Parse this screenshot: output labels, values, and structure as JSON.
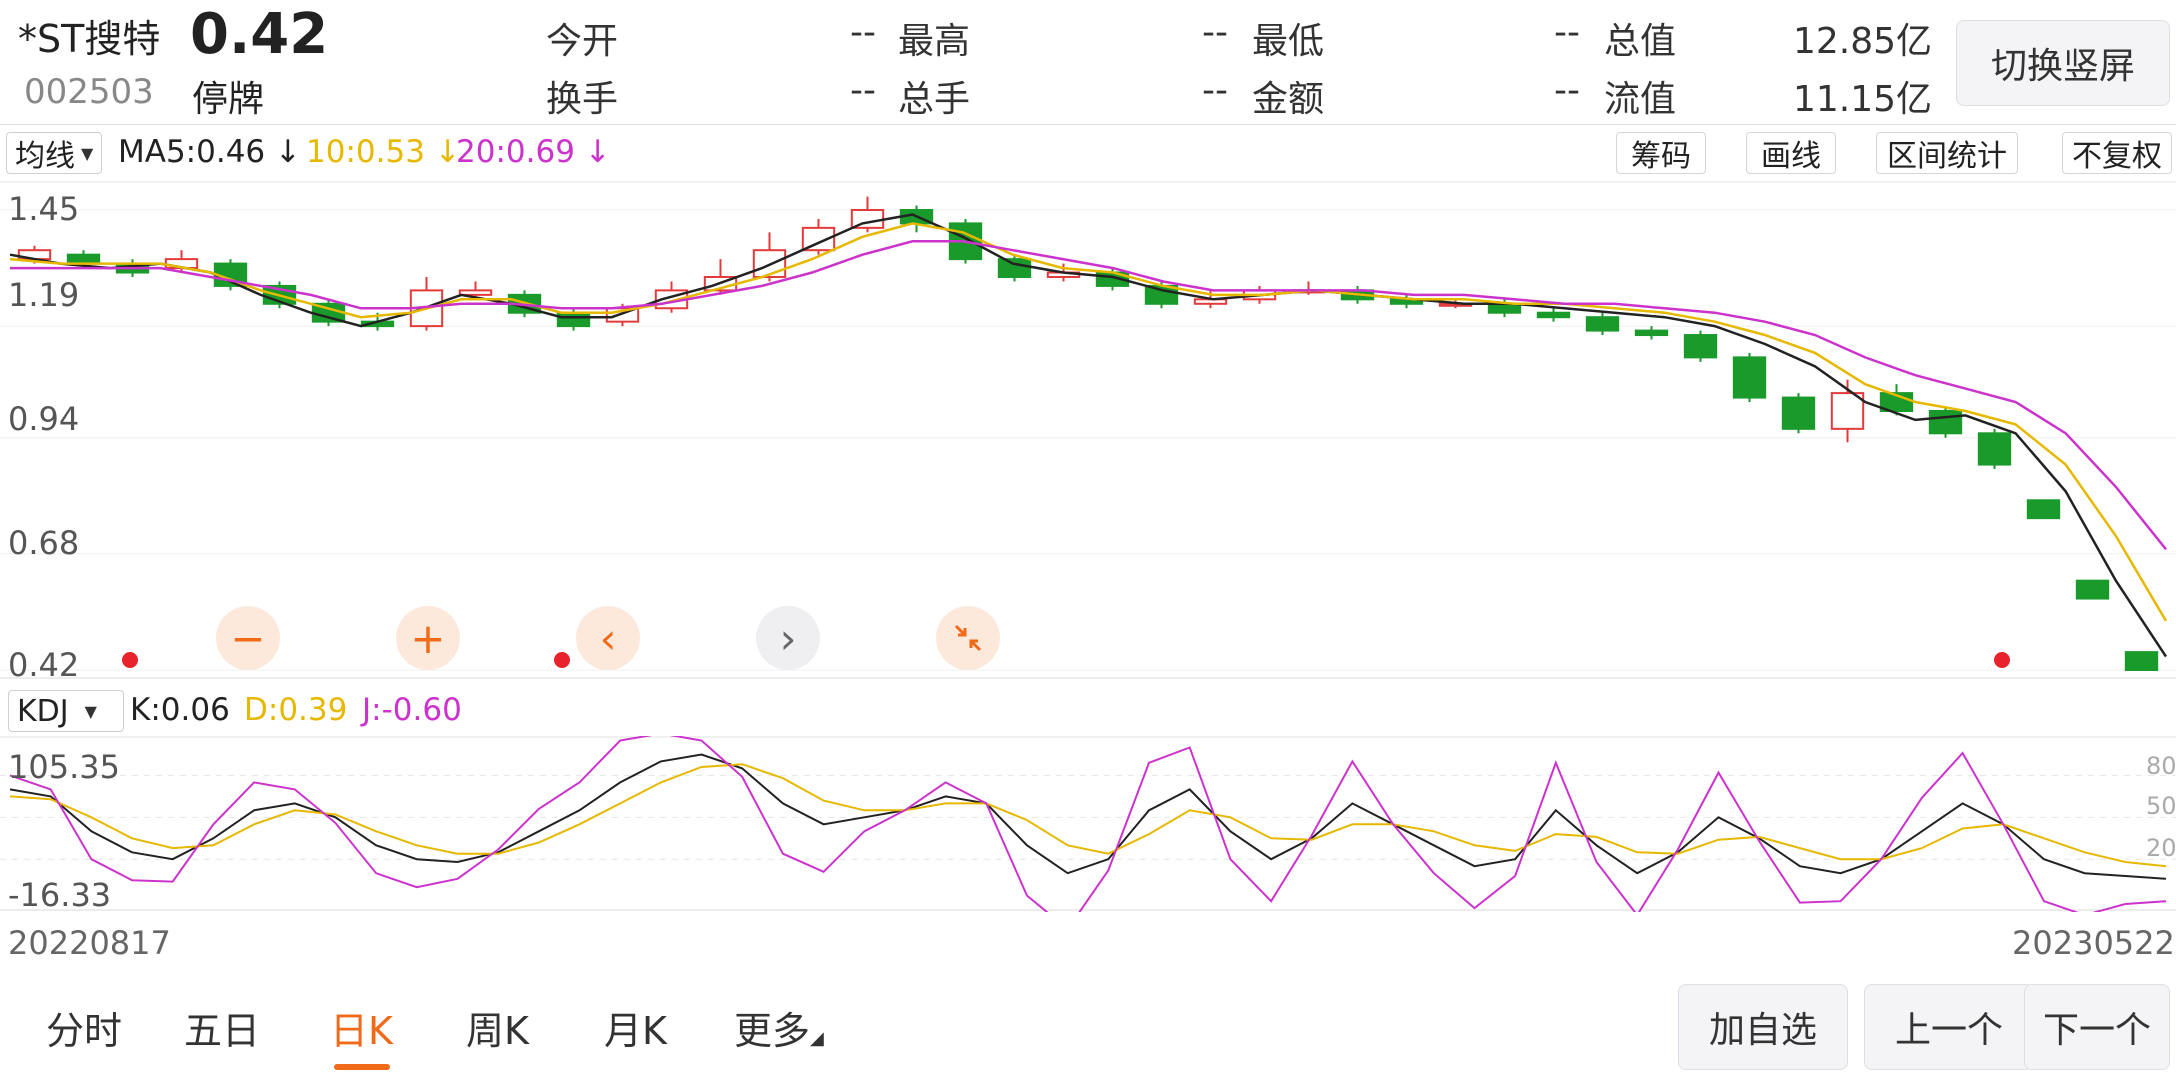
{
  "stock": {
    "name": "*ST搜特",
    "price": "0.42",
    "code": "002503",
    "status": "停牌",
    "quote": [
      {
        "label": "今开",
        "value": "--"
      },
      {
        "label": "最高",
        "value": "--"
      },
      {
        "label": "最低",
        "value": "--"
      },
      {
        "label": "总值",
        "value": "12.85亿"
      },
      {
        "label": "换手",
        "value": "--"
      },
      {
        "label": "总手",
        "value": "--"
      },
      {
        "label": "金额",
        "value": "--"
      },
      {
        "label": "流值",
        "value": "11.15亿"
      }
    ],
    "switch_label": "切换竖屏"
  },
  "ma_bar": {
    "selector": "均线",
    "ma5": "MA5:0.46",
    "ma10": "10:0.53",
    "ma20": "20:0.69",
    "arrow": "↓",
    "buttons": [
      "筹码",
      "画线",
      "区间统计",
      "不复权"
    ]
  },
  "colors": {
    "up": "#e33b3b",
    "down": "#1a9a2a",
    "ma5": "#222222",
    "ma10": "#e6b800",
    "ma20": "#cc33cc",
    "accent": "#f06a1a"
  },
  "price_axis": [
    "1.45",
    "1.19",
    "0.94",
    "0.68",
    "0.42"
  ],
  "controls": [
    {
      "name": "zoom-out-icon",
      "glyph": "−"
    },
    {
      "name": "zoom-in-icon",
      "glyph": "+"
    },
    {
      "name": "chevron-left-icon",
      "glyph": "‹"
    },
    {
      "name": "chevron-right-icon",
      "glyph": "›"
    },
    {
      "name": "collapse-icon",
      "glyph": ""
    }
  ],
  "kdj_bar": {
    "selector": "KDJ",
    "k": "K:0.06",
    "d": "D:0.39",
    "j": "J:-0.60"
  },
  "kdj_axis": {
    "top": "105.35",
    "bottom": "-16.33",
    "right": [
      "80",
      "50",
      "20"
    ]
  },
  "dates": {
    "start": "20220817",
    "end": "20230522"
  },
  "tabs": [
    "分时",
    "五日",
    "日K",
    "周K",
    "月K",
    "更多"
  ],
  "active_tab": "日K",
  "nav": [
    "加自选",
    "上一个",
    "下一个"
  ],
  "chart_data": [
    {
      "type": "candlestick",
      "title": "",
      "ylim": [
        0.42,
        1.45
      ],
      "series": [
        {
          "name": "MA5",
          "values": [
            1.35,
            1.33,
            1.32,
            1.33,
            1.31,
            1.26,
            1.22,
            1.19,
            1.22,
            1.26,
            1.24,
            1.21,
            1.21,
            1.25,
            1.28,
            1.32,
            1.37,
            1.42,
            1.44,
            1.39,
            1.33,
            1.31,
            1.3,
            1.27,
            1.25,
            1.26,
            1.27,
            1.26,
            1.25,
            1.24,
            1.24,
            1.23,
            1.22,
            1.21,
            1.19,
            1.15,
            1.1,
            1.02,
            0.98,
            0.99,
            0.95,
            0.82,
            0.62,
            0.45
          ]
        },
        {
          "name": "10",
          "values": [
            1.34,
            1.33,
            1.33,
            1.33,
            1.31,
            1.27,
            1.24,
            1.21,
            1.22,
            1.25,
            1.25,
            1.22,
            1.22,
            1.24,
            1.27,
            1.3,
            1.34,
            1.39,
            1.42,
            1.4,
            1.35,
            1.32,
            1.31,
            1.28,
            1.26,
            1.26,
            1.27,
            1.26,
            1.25,
            1.25,
            1.24,
            1.24,
            1.23,
            1.22,
            1.2,
            1.17,
            1.13,
            1.06,
            1.02,
            1.0,
            0.97,
            0.88,
            0.72,
            0.53
          ]
        },
        {
          "name": "20",
          "values": [
            1.32,
            1.32,
            1.32,
            1.32,
            1.3,
            1.28,
            1.26,
            1.23,
            1.23,
            1.24,
            1.24,
            1.23,
            1.23,
            1.24,
            1.26,
            1.28,
            1.31,
            1.35,
            1.38,
            1.38,
            1.36,
            1.34,
            1.32,
            1.29,
            1.27,
            1.27,
            1.27,
            1.27,
            1.26,
            1.26,
            1.25,
            1.24,
            1.24,
            1.23,
            1.22,
            1.2,
            1.17,
            1.12,
            1.08,
            1.05,
            1.02,
            0.95,
            0.83,
            0.69
          ]
        }
      ],
      "candles": [
        [
          1.34,
          1.36,
          1.37,
          1.33
        ],
        [
          1.35,
          1.33,
          1.36,
          1.32
        ],
        [
          1.33,
          1.31,
          1.34,
          1.3
        ],
        [
          1.32,
          1.34,
          1.36,
          1.31
        ],
        [
          1.33,
          1.28,
          1.34,
          1.27
        ],
        [
          1.28,
          1.24,
          1.29,
          1.23
        ],
        [
          1.24,
          1.2,
          1.25,
          1.19
        ],
        [
          1.2,
          1.19,
          1.22,
          1.18
        ],
        [
          1.19,
          1.27,
          1.3,
          1.18
        ],
        [
          1.26,
          1.27,
          1.29,
          1.25
        ],
        [
          1.26,
          1.22,
          1.27,
          1.21
        ],
        [
          1.22,
          1.19,
          1.23,
          1.18
        ],
        [
          1.2,
          1.23,
          1.24,
          1.19
        ],
        [
          1.23,
          1.27,
          1.29,
          1.22
        ],
        [
          1.27,
          1.3,
          1.34,
          1.26
        ],
        [
          1.3,
          1.36,
          1.4,
          1.29
        ],
        [
          1.36,
          1.41,
          1.43,
          1.35
        ],
        [
          1.41,
          1.45,
          1.48,
          1.4
        ],
        [
          1.45,
          1.42,
          1.46,
          1.4
        ],
        [
          1.42,
          1.34,
          1.43,
          1.33
        ],
        [
          1.34,
          1.3,
          1.35,
          1.29
        ],
        [
          1.3,
          1.31,
          1.33,
          1.29
        ],
        [
          1.31,
          1.28,
          1.32,
          1.27
        ],
        [
          1.28,
          1.24,
          1.29,
          1.23
        ],
        [
          1.24,
          1.25,
          1.27,
          1.23
        ],
        [
          1.25,
          1.27,
          1.28,
          1.24
        ],
        [
          1.27,
          1.27,
          1.29,
          1.26
        ],
        [
          1.27,
          1.25,
          1.28,
          1.24
        ],
        [
          1.25,
          1.24,
          1.26,
          1.23
        ],
        [
          1.24,
          1.24,
          1.25,
          1.23
        ],
        [
          1.24,
          1.22,
          1.25,
          1.21
        ],
        [
          1.22,
          1.21,
          1.23,
          1.2
        ],
        [
          1.21,
          1.18,
          1.22,
          1.17
        ],
        [
          1.18,
          1.17,
          1.19,
          1.16
        ],
        [
          1.17,
          1.12,
          1.18,
          1.11
        ],
        [
          1.12,
          1.03,
          1.13,
          1.02
        ],
        [
          1.03,
          0.96,
          1.04,
          0.95
        ],
        [
          0.96,
          1.04,
          1.07,
          0.93
        ],
        [
          1.04,
          1.0,
          1.06,
          0.99
        ],
        [
          1.0,
          0.95,
          1.01,
          0.94
        ],
        [
          0.95,
          0.88,
          0.96,
          0.87
        ],
        [
          0.8,
          0.76,
          0.8,
          0.76
        ],
        [
          0.62,
          0.58,
          0.62,
          0.58
        ],
        [
          0.46,
          0.42,
          0.46,
          0.42
        ]
      ]
    },
    {
      "type": "line",
      "title": "",
      "ylim": [
        -16.33,
        105.35
      ],
      "series": [
        {
          "name": "K",
          "values": [
            70,
            65,
            40,
            25,
            20,
            35,
            55,
            60,
            50,
            30,
            20,
            18,
            25,
            40,
            55,
            75,
            90,
            95,
            85,
            60,
            45,
            50,
            55,
            65,
            60,
            30,
            10,
            20,
            55,
            70,
            40,
            20,
            35,
            60,
            45,
            30,
            15,
            20,
            55,
            30,
            10,
            25,
            50,
            35,
            15,
            10,
            20,
            40,
            60,
            45,
            20,
            10,
            8,
            6
          ]
        },
        {
          "name": "D",
          "values": [
            65,
            63,
            50,
            35,
            28,
            30,
            45,
            55,
            52,
            40,
            30,
            24,
            24,
            32,
            45,
            60,
            75,
            86,
            88,
            78,
            62,
            55,
            55,
            60,
            60,
            48,
            30,
            24,
            38,
            55,
            50,
            35,
            34,
            45,
            45,
            40,
            30,
            26,
            38,
            36,
            25,
            24,
            34,
            36,
            28,
            20,
            20,
            28,
            42,
            45,
            35,
            25,
            18,
            15
          ]
        },
        {
          "name": "J",
          "values": [
            80,
            70,
            20,
            5,
            4,
            45,
            75,
            70,
            46,
            10,
            0,
            6,
            27,
            56,
            75,
            105,
            110,
            105,
            79,
            24,
            11,
            40,
            55,
            75,
            60,
            -6,
            -30,
            12,
            89,
            100,
            20,
            -10,
            37,
            90,
            45,
            10,
            -15,
            8,
            89,
            18,
            -20,
            27,
            82,
            33,
            -11,
            -10,
            20,
            64,
            96,
            45,
            -10,
            -20,
            -12,
            -10
          ]
        }
      ]
    }
  ]
}
